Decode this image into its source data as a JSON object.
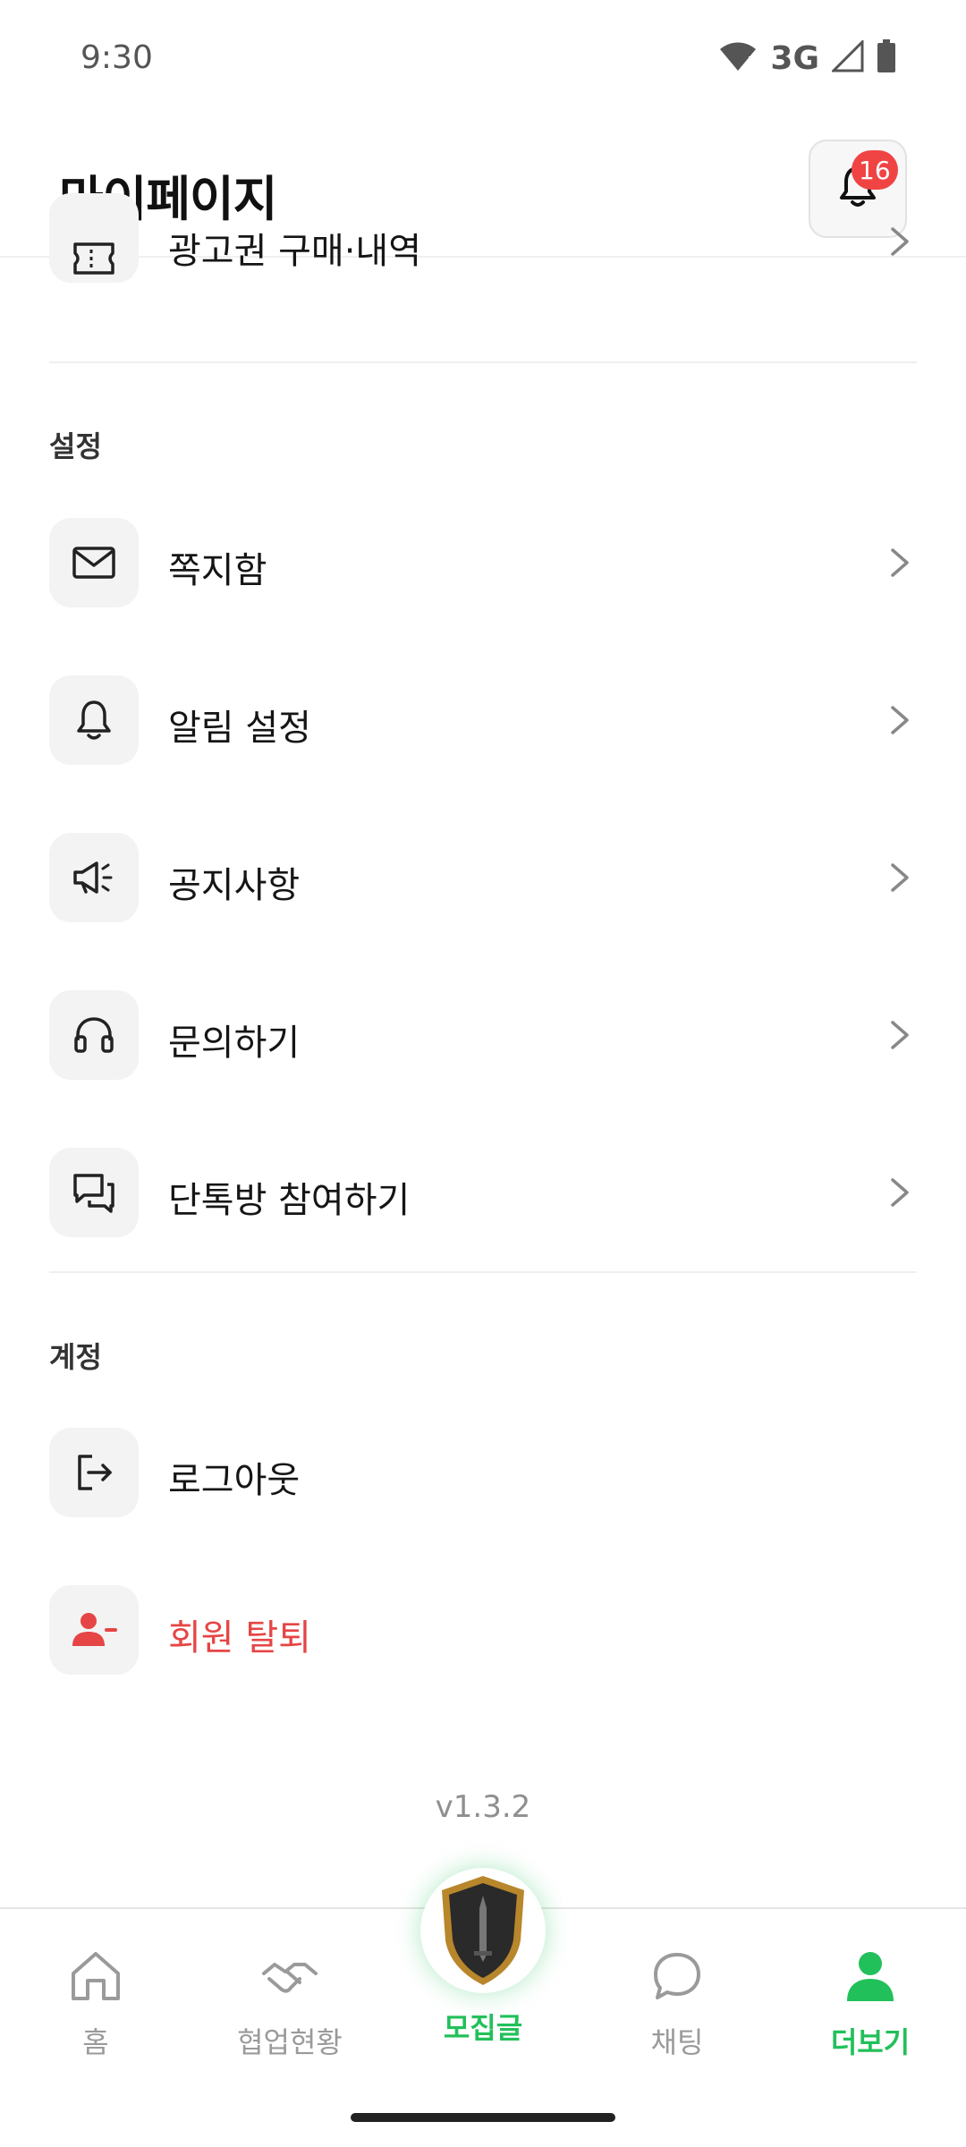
{
  "status_bar": {
    "time": "9:30",
    "network": "3G"
  },
  "header": {
    "title": "마이페이지",
    "notification_count": "16"
  },
  "menu": {
    "ad_ticket": {
      "label": "광고권 구매·내역"
    },
    "settings_section": "설정",
    "settings_items": [
      {
        "label": "쪽지함",
        "icon": "mail-icon"
      },
      {
        "label": "알림 설정",
        "icon": "bell-icon"
      },
      {
        "label": "공지사항",
        "icon": "megaphone-icon"
      },
      {
        "label": "문의하기",
        "icon": "headset-icon"
      },
      {
        "label": "단톡방 참여하기",
        "icon": "chat-bubbles-icon"
      }
    ],
    "account_section": "계정",
    "account_items": [
      {
        "label": "로그아웃",
        "icon": "logout-icon"
      },
      {
        "label": "회원 탈퇴",
        "icon": "user-minus-icon"
      }
    ]
  },
  "version": "v1.3.2",
  "bottom_nav": {
    "items": [
      {
        "label": "홈"
      },
      {
        "label": "협업현황"
      },
      {
        "label": "모집글"
      },
      {
        "label": "채팅"
      },
      {
        "label": "더보기"
      }
    ],
    "active_index": 4
  },
  "colors": {
    "accent": "#22c05a",
    "danger": "#e64545",
    "badge": "#f04444"
  }
}
